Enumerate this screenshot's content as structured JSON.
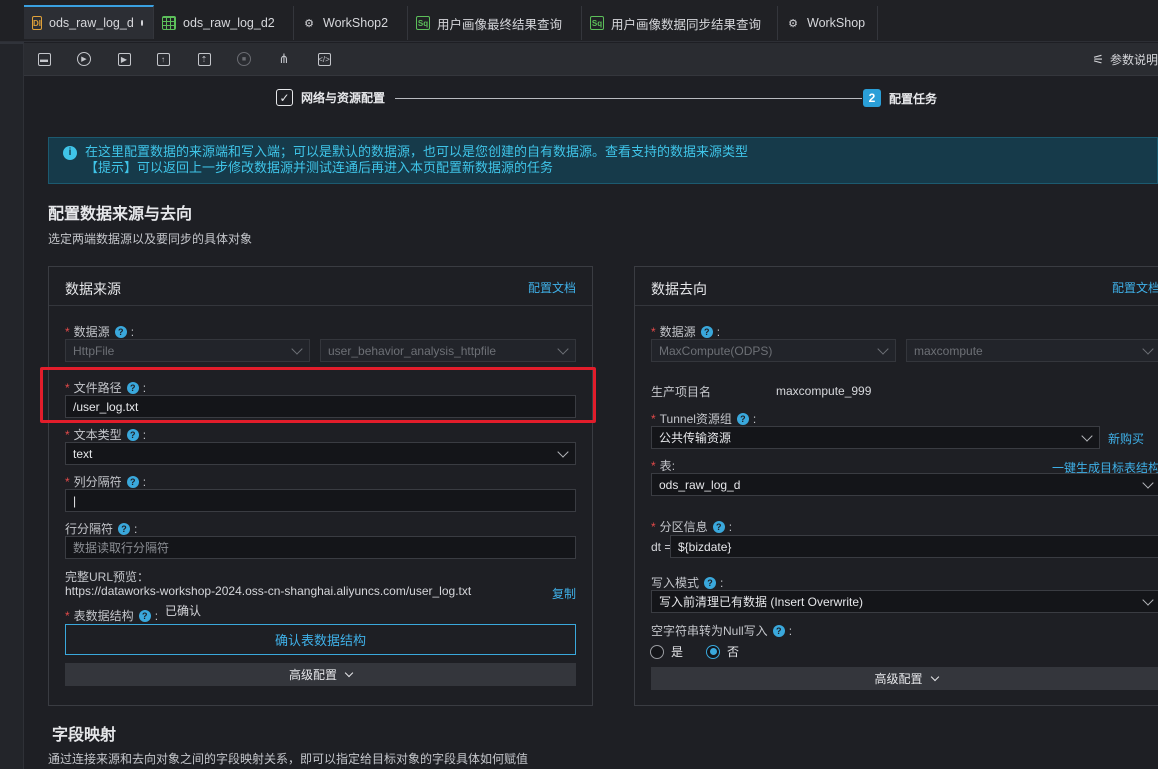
{
  "tabs": [
    {
      "label": "ods_raw_log_d",
      "icon": "di-icon",
      "active": true,
      "modified": true
    },
    {
      "label": "ods_raw_log_d2",
      "icon": "table-icon"
    },
    {
      "label": "WorkShop2",
      "icon": "workflow-icon"
    },
    {
      "label": "用户画像最终结果查询",
      "icon": "sql-icon"
    },
    {
      "label": "用户画像数据同步结果查询",
      "icon": "sql-icon"
    },
    {
      "label": "WorkShop",
      "icon": "workflow-icon"
    }
  ],
  "toolbar": {
    "params_label": "参数说明",
    "icons": [
      "save-icon",
      "run-icon",
      "run-param-icon",
      "submit-icon",
      "publish-icon",
      "stop-icon",
      "lineage-icon",
      "code-icon",
      "sliders-icon"
    ]
  },
  "steps": [
    {
      "label": "网络与资源配置",
      "done": true
    },
    {
      "number": "2",
      "label": "配置任务"
    }
  ],
  "info": {
    "line1": "在这里配置数据的来源端和写入端；可以是默认的数据源，也可以是您创建的自有数据源。查看支持的数据来源类型",
    "line2": "【提示】可以返回上一步修改数据源并测试连通后再进入本页配置新数据源的任务"
  },
  "section": {
    "title": "配置数据来源与去向",
    "desc": "选定两端数据源以及要同步的具体对象"
  },
  "source": {
    "title": "数据来源",
    "doc_link": "配置文档",
    "datasource_label": "数据源",
    "datasource_type": "HttpFile",
    "datasource_name": "user_behavior_analysis_httpfile",
    "filepath_label": "文件路径",
    "filepath_value": "/user_log.txt",
    "texttype_label": "文本类型",
    "texttype_value": "text",
    "coldelim_label": "列分隔符",
    "coldelim_value": "|",
    "rowdelim_label": "行分隔符",
    "rowdelim_placeholder": "数据读取行分隔符",
    "url_label": "完整URL预览：",
    "url_value": "https://dataworks-workshop-2024.oss-cn-shanghai.aliyuncs.com/user_log.txt",
    "copy_label": "复制",
    "schema_label": "表数据结构",
    "schema_status": "已确认",
    "confirm_button": "确认表数据结构",
    "advanced": "高级配置"
  },
  "target": {
    "title": "数据去向",
    "doc_link": "配置文档",
    "datasource_label": "数据源",
    "datasource_type": "MaxCompute(ODPS)",
    "datasource_name": "maxcompute",
    "project_label": "生产项目名",
    "project_value": "maxcompute_999",
    "tunnel_label": "Tunnel资源组",
    "tunnel_value": "公共传输资源",
    "buy_link": "新购买",
    "table_label": "表",
    "gen_link": "一键生成目标表结构",
    "table_value": "ods_raw_log_d",
    "partition_label": "分区信息",
    "partition_key": "dt =",
    "partition_value": "${bizdate}",
    "write_label": "写入模式",
    "write_value": "写入前清理已有数据 (Insert Overwrite)",
    "null_label": "空字符串转为Null写入",
    "yes": "是",
    "no": "否",
    "null_selected": "否",
    "advanced": "高级配置"
  },
  "mapping": {
    "title": "字段映射",
    "desc": "通过连接来源和去向对象之间的字段映射关系，即可以指定给目标对象的字段具体如何赋值"
  },
  "colors": {
    "accent": "#3aa8dc",
    "required": "#e34a4a",
    "highlight": "#e21d2b"
  }
}
